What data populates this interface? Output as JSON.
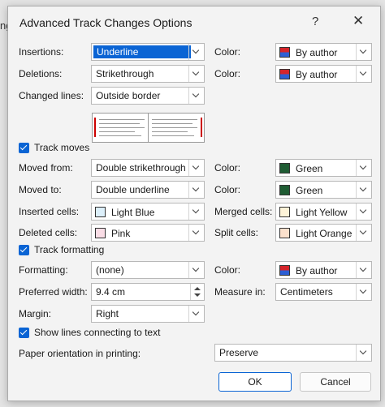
{
  "background_text": "ng",
  "dialog": {
    "title": "Advanced Track Changes Options",
    "help": "?",
    "close": "✕"
  },
  "insertions": {
    "label": "Insertions:",
    "value": "Underline",
    "color_label": "Color:",
    "color_value": "By author"
  },
  "deletions": {
    "label": "Deletions:",
    "value": "Strikethrough",
    "color_label": "Color:",
    "color_value": "By author"
  },
  "changed_lines": {
    "label": "Changed lines:",
    "value": "Outside border"
  },
  "track_moves": {
    "label": "Track moves",
    "checked": true
  },
  "moved_from": {
    "label": "Moved from:",
    "value": "Double strikethrough",
    "color_label": "Color:",
    "color_value": "Green",
    "swatch": "#1f5c33"
  },
  "moved_to": {
    "label": "Moved to:",
    "value": "Double underline",
    "color_label": "Color:",
    "color_value": "Green",
    "swatch": "#1f5c33"
  },
  "inserted_cells": {
    "label": "Inserted cells:",
    "value": "Light Blue",
    "swatch": "#dceffa"
  },
  "merged_cells": {
    "label": "Merged cells:",
    "value": "Light Yellow",
    "swatch": "#fdf3d8"
  },
  "deleted_cells": {
    "label": "Deleted cells:",
    "value": "Pink",
    "swatch": "#fadde6"
  },
  "split_cells": {
    "label": "Split cells:",
    "value": "Light Orange",
    "swatch": "#fbe0cc"
  },
  "track_formatting": {
    "label": "Track formatting",
    "checked": true
  },
  "formatting": {
    "label": "Formatting:",
    "value": "(none)",
    "color_label": "Color:",
    "color_value": "By author"
  },
  "preferred_width": {
    "label": "Preferred width:",
    "value": "9.4 cm",
    "measure_label": "Measure in:",
    "measure_value": "Centimeters"
  },
  "margin": {
    "label": "Margin:",
    "value": "Right"
  },
  "show_lines": {
    "label": "Show lines connecting to text",
    "checked": true
  },
  "paper_orientation": {
    "label": "Paper orientation in printing:",
    "value": "Preserve"
  },
  "buttons": {
    "ok": "OK",
    "cancel": "Cancel"
  },
  "colors": {
    "accent": "#0a64d4",
    "author_top": "#d5252b",
    "author_bottom": "#2d5fd4"
  }
}
